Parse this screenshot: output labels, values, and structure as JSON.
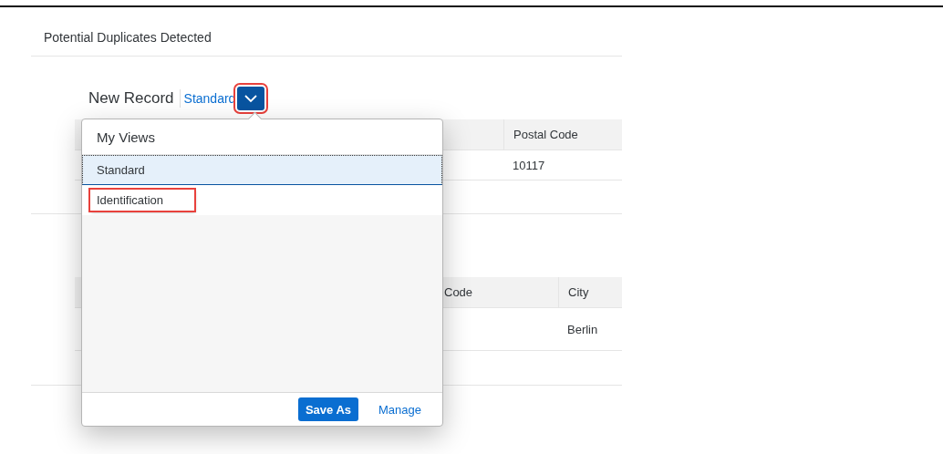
{
  "title": "Potential Duplicates Detected",
  "record": {
    "heading": "New Record",
    "view": "Standard",
    "view_button": {
      "highlighted": true
    }
  },
  "tables": [
    {
      "columns": [
        {
          "label": "Postal Code",
          "value": "10117"
        }
      ]
    },
    {
      "columns": [
        {
          "label": "Code"
        },
        {
          "label": "City",
          "value": "Berlin"
        }
      ]
    }
  ],
  "popover": {
    "title": "My Views",
    "items": [
      {
        "label": "Standard",
        "selected": true,
        "highlighted": false
      },
      {
        "label": "Identification",
        "selected": false,
        "highlighted": true
      }
    ],
    "buttons": [
      {
        "label": "Save As",
        "kind": "primary"
      },
      {
        "label": "Manage",
        "kind": "link"
      }
    ]
  }
}
